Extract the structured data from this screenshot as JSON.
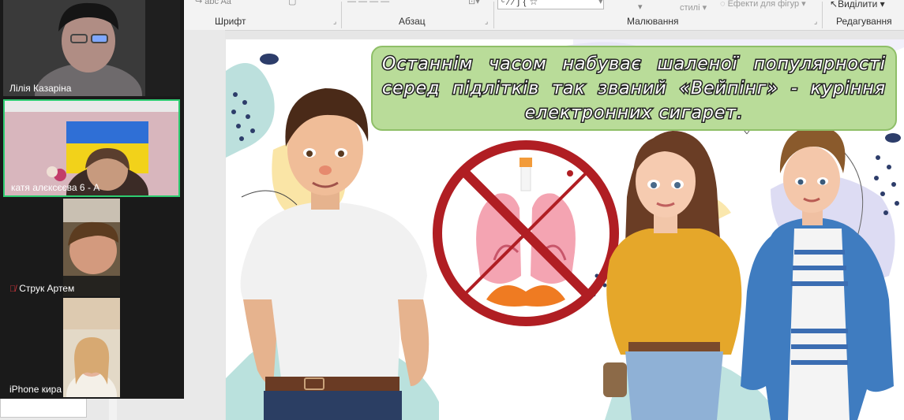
{
  "ribbon": {
    "groups": {
      "font": "Шрифт",
      "paragraph": "Абзац",
      "drawing": "Малювання",
      "editing": "Редагування"
    },
    "styles_label": "стилі",
    "shape_effects_label": "Ефекти для фігур",
    "select_label": "Виділити"
  },
  "participants": [
    {
      "name": "Лілія Казаріна",
      "muted": false,
      "active": false
    },
    {
      "name": "катя алєксєєва 6 - А",
      "muted": false,
      "active": true
    },
    {
      "name": "Струк Артем",
      "muted": true,
      "active": false
    },
    {
      "name": "iPhone кира",
      "muted": false,
      "active": false
    }
  ],
  "slide": {
    "callout_text": "Останнім часом набуває шаленої популярності серед підлітків так званий «Вейпінг» - куріння електронних сигарет."
  },
  "colors": {
    "active_speaker_border": "#2ecc71",
    "callout_fill": "#b9dc99",
    "prohibition_red": "#b01e23"
  }
}
